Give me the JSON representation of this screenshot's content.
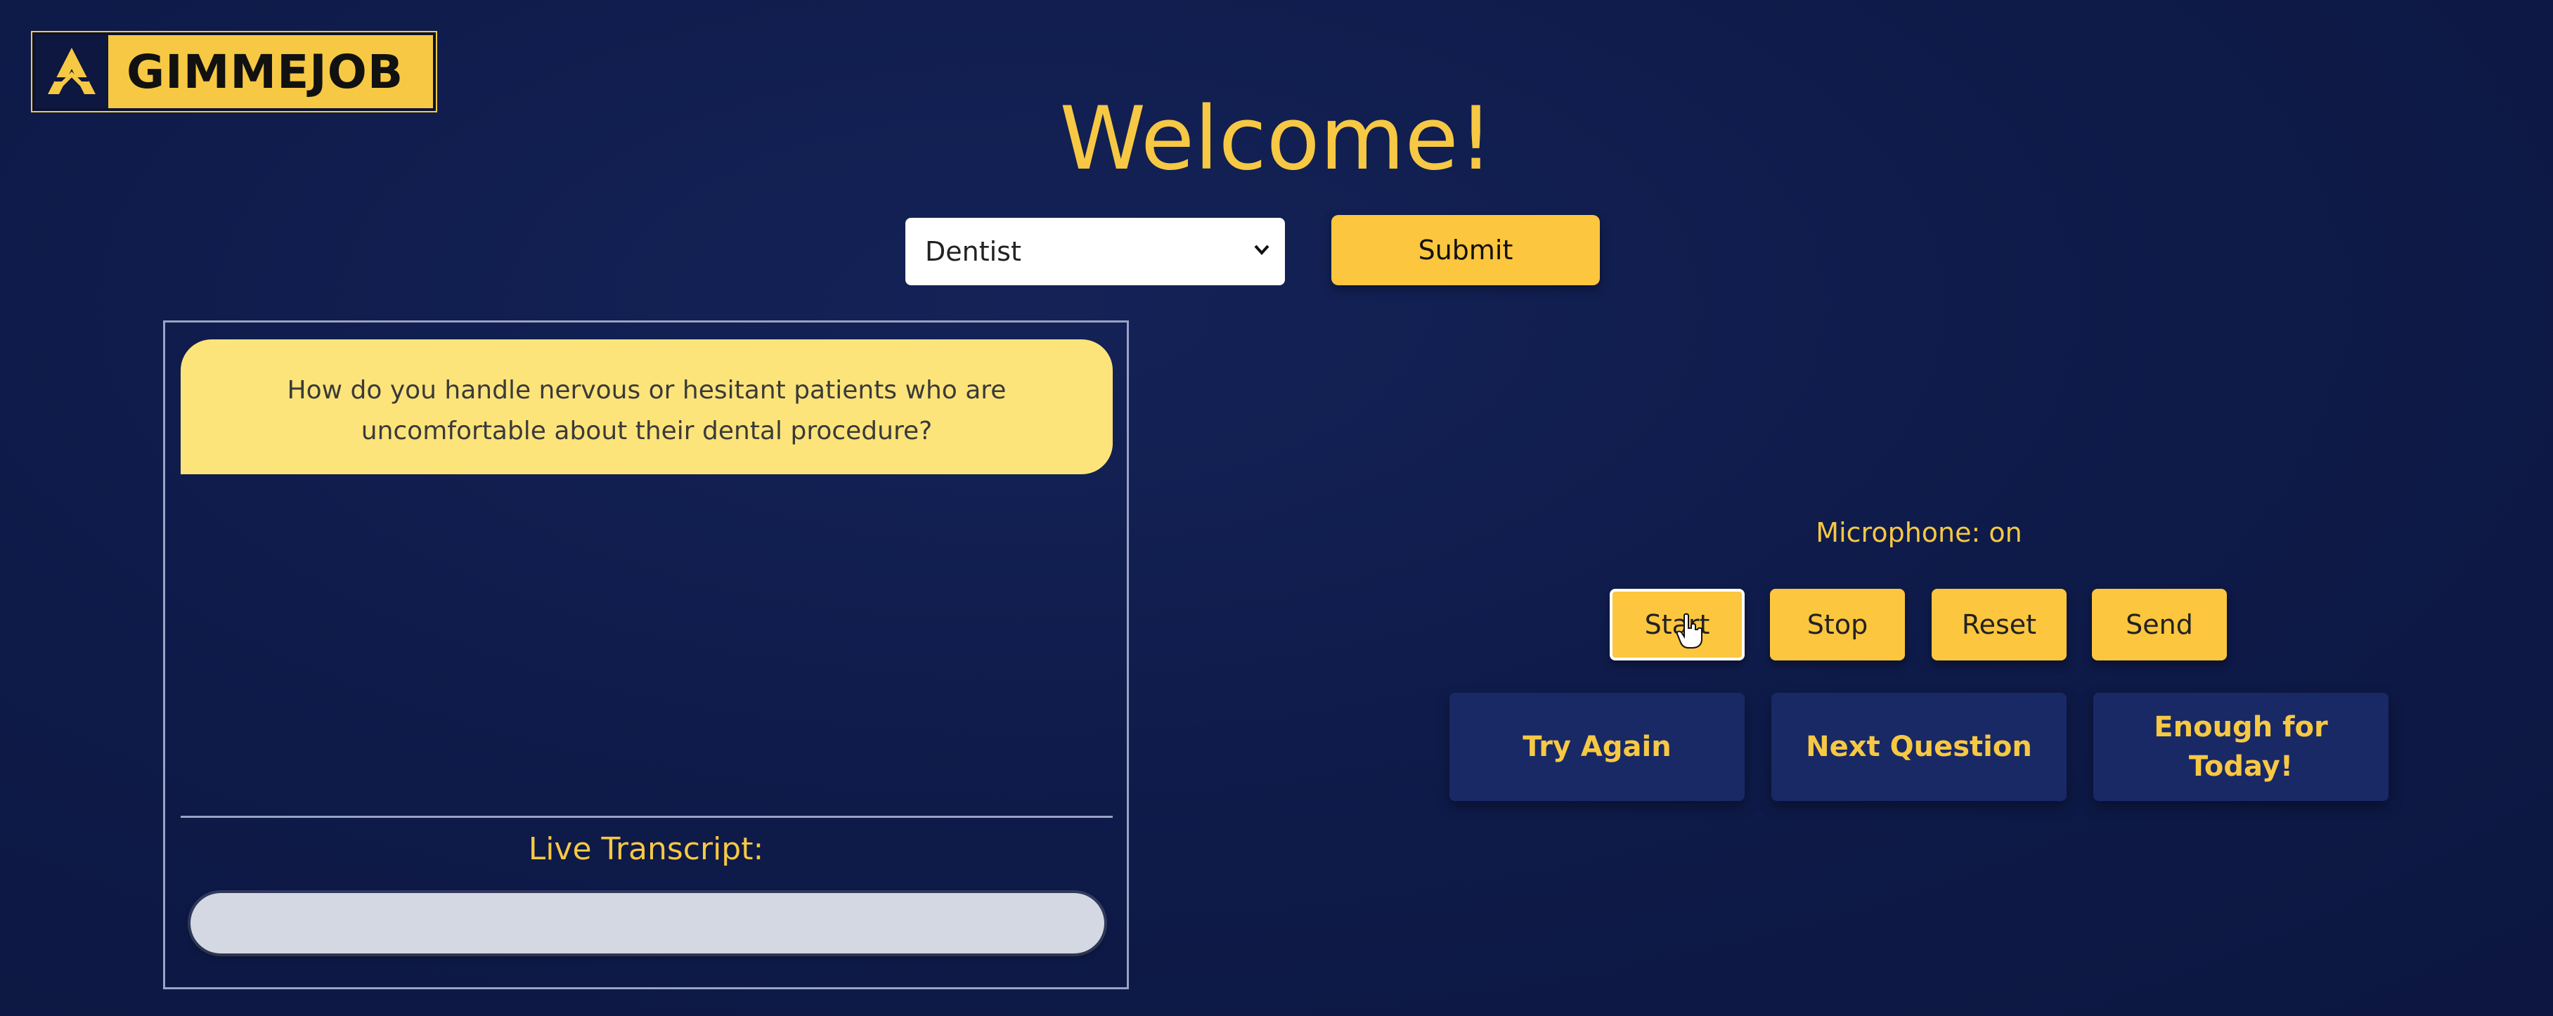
{
  "brand": {
    "name": "GIMMEJOB",
    "logo_icon": "a-mountain-logo-icon"
  },
  "header": {
    "title": "Welcome!"
  },
  "role_select": {
    "selected": "Dentist",
    "chevron_icon": "chevron-down-icon"
  },
  "submit": {
    "label": "Submit"
  },
  "chat": {
    "question": "How do you handle nervous or hesitant patients who are uncomfortable about their dental procedure?",
    "transcript_label": "Live Transcript:",
    "transcript_value": ""
  },
  "microphone": {
    "status": "Microphone: on"
  },
  "controls": {
    "start": "Start",
    "stop": "Stop",
    "reset": "Reset",
    "send": "Send"
  },
  "actions": {
    "try_again": "Try Again",
    "next_question": "Next Question",
    "enough": "Enough for Today!"
  },
  "colors": {
    "background": "#0f1b4a",
    "accent": "#fcc63e",
    "bubble": "#fde47a",
    "nav_button": "#192966"
  }
}
